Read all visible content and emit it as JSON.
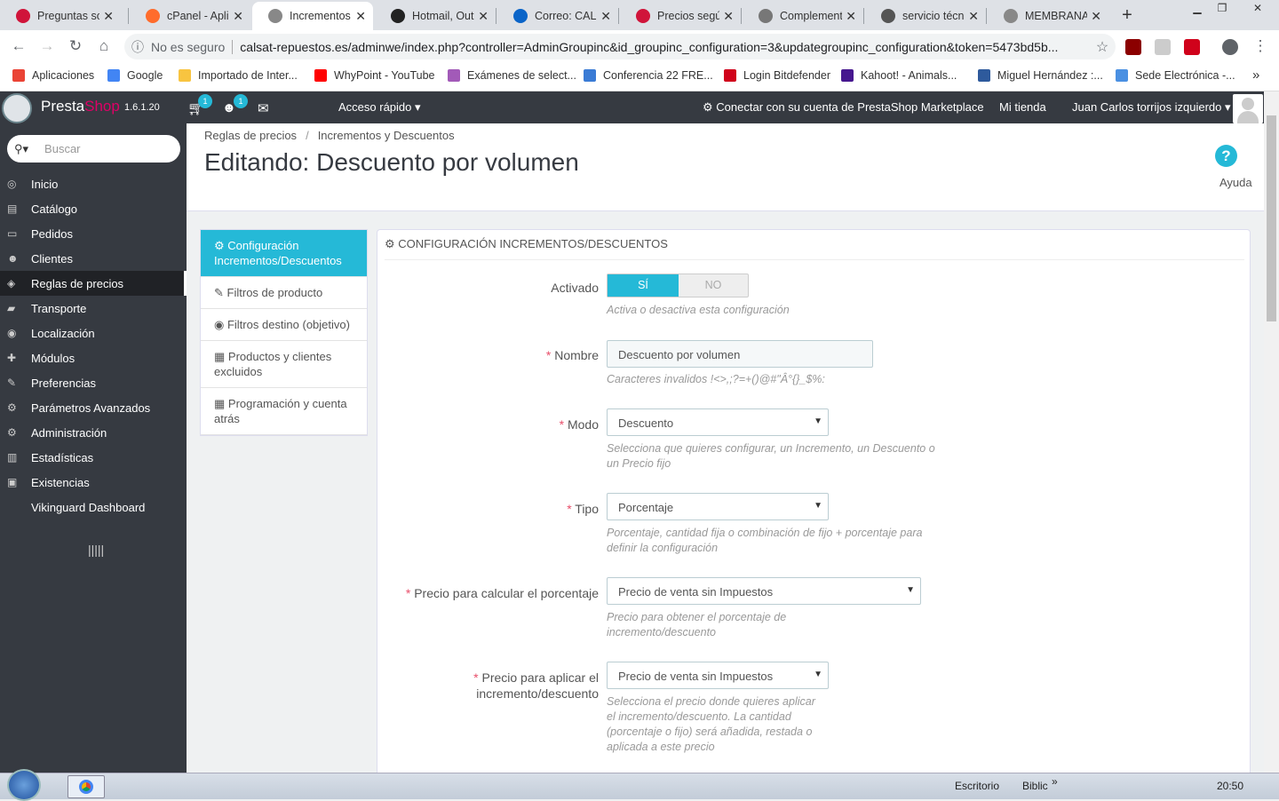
{
  "browser": {
    "tabs": [
      {
        "title": "Preguntas sob",
        "icon_color": "#d0143a",
        "active": false
      },
      {
        "title": "cPanel - Aplic",
        "icon_color": "#ff6c2c",
        "active": false
      },
      {
        "title": "Incrementos y",
        "icon_color": "#888888",
        "active": true
      },
      {
        "title": "Hotmail, Outl",
        "icon_color": "#222222",
        "active": false
      },
      {
        "title": "Correo: CAL-S",
        "icon_color": "#0a64c8",
        "active": false
      },
      {
        "title": "Precios según",
        "icon_color": "#d0143a",
        "active": false
      },
      {
        "title": "Complemento",
        "icon_color": "#777777",
        "active": false
      },
      {
        "title": "servicio técnic",
        "icon_color": "#555555",
        "active": false
      },
      {
        "title": "MEMBRANA P",
        "icon_color": "#888888",
        "active": false
      }
    ],
    "new_tab": "+",
    "security_label": "No es seguro",
    "url": "calsat-repuestos.es/adminwe/index.php?controller=AdminGroupinc&id_groupinc_configuration=3&updategroupinc_configuration&token=5473bd5b...",
    "bookmarks": [
      {
        "label": "Aplicaciones",
        "color": "#ea4335"
      },
      {
        "label": "Google",
        "color": "#4285f4"
      },
      {
        "label": "Importado de Inter...",
        "color": "#f8c440"
      },
      {
        "label": "WhyPoint - YouTube",
        "color": "#ff0000"
      },
      {
        "label": "Exámenes de select...",
        "color": "#a25ab8"
      },
      {
        "label": "Conferencia 22 FRE...",
        "color": "#3a7bd5"
      },
      {
        "label": "Login Bitdefender",
        "color": "#d0021b"
      },
      {
        "label": "Kahoot! - Animals...",
        "color": "#46178f"
      },
      {
        "label": "Miguel Hernández :...",
        "color": "#2e5a9c"
      },
      {
        "label": "Sede Electrónica -...",
        "color": "#4a90e2"
      }
    ],
    "bookmarks_more": "»"
  },
  "header": {
    "brand_a": "Presta",
    "brand_b": "Shop",
    "version": "1.6.1.20",
    "cart_badge": "1",
    "customer_badge": "1",
    "quick_access": "Acceso rápido",
    "marketplace": "Conectar con su cuenta de PrestaShop Marketplace",
    "my_shop": "Mi tienda",
    "user": "Juan Carlos torrijos izquierdo"
  },
  "sidebar": {
    "search_placeholder": "Buscar",
    "items": [
      {
        "label": "Inicio",
        "icon": "dashboard-icon",
        "glyph": "◎"
      },
      {
        "label": "Catálogo",
        "icon": "book-icon",
        "glyph": "▤"
      },
      {
        "label": "Pedidos",
        "icon": "credit-card-icon",
        "glyph": "▭"
      },
      {
        "label": "Clientes",
        "icon": "users-icon",
        "glyph": "☻"
      },
      {
        "label": "Reglas de precios",
        "icon": "tags-icon",
        "glyph": "◈"
      },
      {
        "label": "Transporte",
        "icon": "truck-icon",
        "glyph": "▰"
      },
      {
        "label": "Localización",
        "icon": "globe-icon",
        "glyph": "◉"
      },
      {
        "label": "Módulos",
        "icon": "puzzle-icon",
        "glyph": "✚"
      },
      {
        "label": "Preferencias",
        "icon": "wrench-icon",
        "glyph": "✎"
      },
      {
        "label": "Parámetros Avanzados",
        "icon": "cogs-icon",
        "glyph": "⚙"
      },
      {
        "label": "Administración",
        "icon": "cog-icon",
        "glyph": "⚙"
      },
      {
        "label": "Estadísticas",
        "icon": "bar-chart-icon",
        "glyph": "▥"
      },
      {
        "label": "Existencias",
        "icon": "archive-icon",
        "glyph": "▣"
      },
      {
        "label": "Vikinguard Dashboard",
        "icon": "",
        "glyph": ""
      }
    ],
    "active_index": 4
  },
  "page": {
    "breadcrumb": [
      "Reglas de precios",
      "Incrementos y Descuentos"
    ],
    "title": "Editando: Descuento por volumen",
    "help_label": "Ayuda"
  },
  "left_tabs": [
    {
      "label": "Configuración Incrementos/Descuentos",
      "icon": "cogs-icon",
      "glyph": "⚙"
    },
    {
      "label": "Filtros de producto",
      "icon": "edit-icon",
      "glyph": "✎"
    },
    {
      "label": "Filtros destino (objetivo)",
      "icon": "globe-icon",
      "glyph": "◉"
    },
    {
      "label": "Productos y clientes excluidos",
      "icon": "calendar-icon",
      "glyph": "▦"
    },
    {
      "label": "Programación y cuenta atrás",
      "icon": "calendar-icon",
      "glyph": "▦"
    }
  ],
  "form": {
    "panel_title": "CONFIGURACIÓN INCREMENTOS/DESCUENTOS",
    "activado": {
      "label": "Activado",
      "yes": "SÍ",
      "no": "NO",
      "value": "SÍ",
      "help": "Activa o desactiva esta configuración"
    },
    "nombre": {
      "label": "Nombre",
      "value": "Descuento por volumen",
      "help": "Caracteres invalidos !<>,;?=+()@#\"Â°{}_$%:"
    },
    "modo": {
      "label": "Modo",
      "value": "Descuento",
      "help": "Selecciona que quieres configurar, un Incremento, un Descuento o un Precio fijo"
    },
    "tipo": {
      "label": "Tipo",
      "value": "Porcentaje",
      "help": "Porcentaje, cantidad fija o combinación de fijo + porcentaje para definir la configuración"
    },
    "precio_calc": {
      "label": "Precio para calcular el porcentaje",
      "value": "Precio de venta sin Impuestos",
      "help": "Precio para obtener el porcentaje de incremento/descuento"
    },
    "precio_aplicar": {
      "label": "Precio para aplicar el incremento/descuento",
      "value": "Precio de venta sin Impuestos",
      "help": "Selecciona el precio donde quieres aplicar el incremento/descuento. La cantidad (porcentaje o fijo) será añadida, restada o aplicada a este precio"
    }
  },
  "taskbar": {
    "desktop": "Escritorio",
    "library": "Biblic",
    "more": "»",
    "clock": "20:50"
  }
}
